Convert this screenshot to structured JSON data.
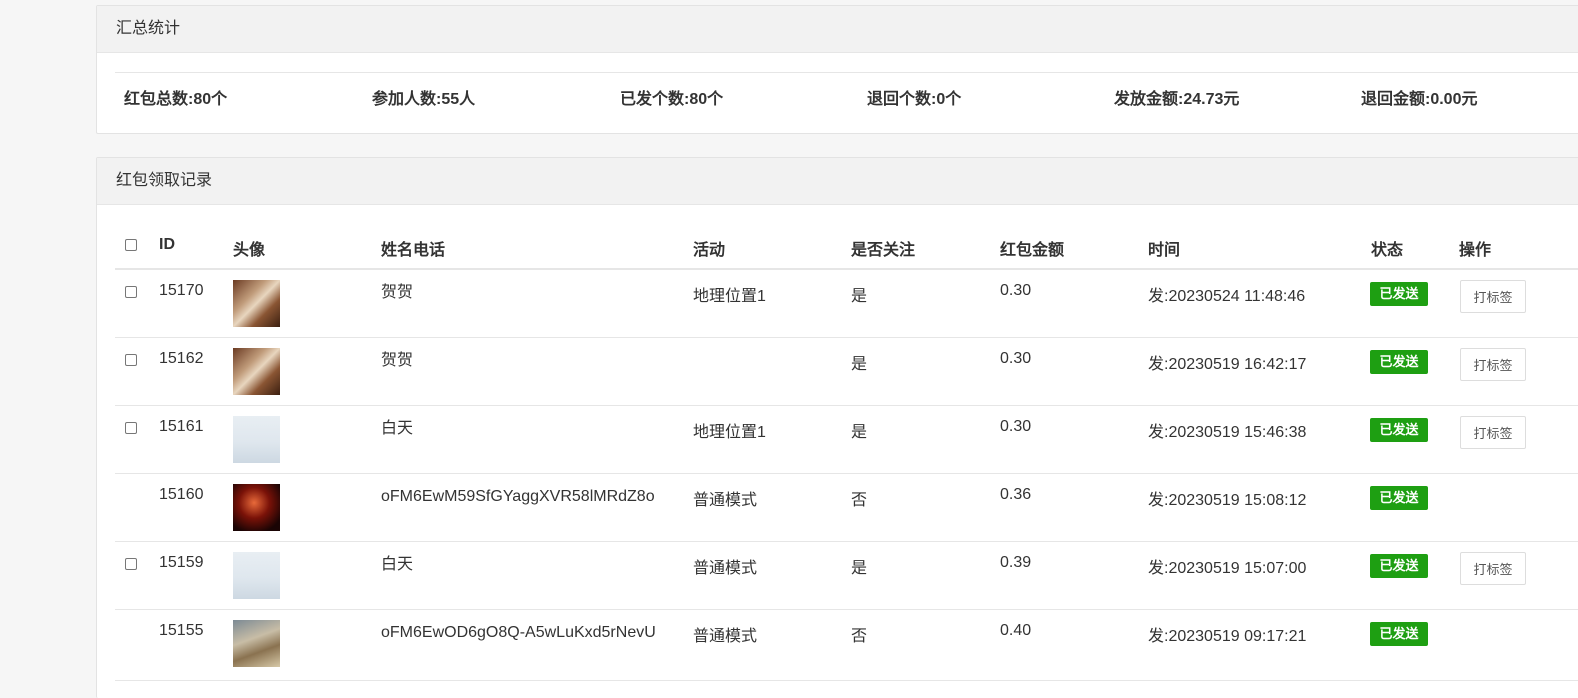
{
  "summary": {
    "title": "汇总统计",
    "stats": [
      "红包总数:80个",
      "参加人数:55人",
      "已发个数:80个",
      "退回个数:0个",
      "发放金额:24.73元",
      "退回金额:0.00元"
    ]
  },
  "records": {
    "title": "红包领取记录",
    "columns": [
      "ID",
      "头像",
      "姓名电话",
      "活动",
      "是否关注",
      "红包金额",
      "时间",
      "状态",
      "操作"
    ],
    "rows": [
      {
        "id": "15170",
        "name": "贺贺",
        "activity": "地理位置1",
        "follow": "是",
        "amount": "0.30",
        "time": "发:20230524 11:48:46",
        "status": "已发送",
        "action": "打标签",
        "avatar": "photo-family"
      },
      {
        "id": "15162",
        "name": "贺贺",
        "activity": "",
        "follow": "是",
        "amount": "0.30",
        "time": "发:20230519 16:42:17",
        "status": "已发送",
        "action": "打标签",
        "avatar": "photo-family"
      },
      {
        "id": "15161",
        "name": "白天",
        "activity": "地理位置1",
        "follow": "是",
        "amount": "0.30",
        "time": "发:20230519 15:46:38",
        "status": "已发送",
        "action": "打标签",
        "avatar": "placeholder"
      },
      {
        "id": "15160",
        "name": "oFM6EwM59SfGYaggXVR58lMRdZ8o",
        "activity": "普通模式",
        "follow": "否",
        "amount": "0.36",
        "time": "发:20230519 15:08:12",
        "status": "已发送",
        "action": "",
        "avatar": "photo-dark"
      },
      {
        "id": "15159",
        "name": "白天",
        "activity": "普通模式",
        "follow": "是",
        "amount": "0.39",
        "time": "发:20230519 15:07:00",
        "status": "已发送",
        "action": "打标签",
        "avatar": "placeholder"
      },
      {
        "id": "15155",
        "name": "oFM6EwOD6gO8Q-A5wLuKxd5rNevU",
        "activity": "普通模式",
        "follow": "否",
        "amount": "0.40",
        "time": "发:20230519 09:17:21",
        "status": "已发送",
        "action": "",
        "avatar": "photo-landscape"
      }
    ]
  },
  "colors": {
    "status_sent": "#1e9f12",
    "header_bg": "#f2f2f2",
    "page_bg": "#f6f6f6"
  }
}
